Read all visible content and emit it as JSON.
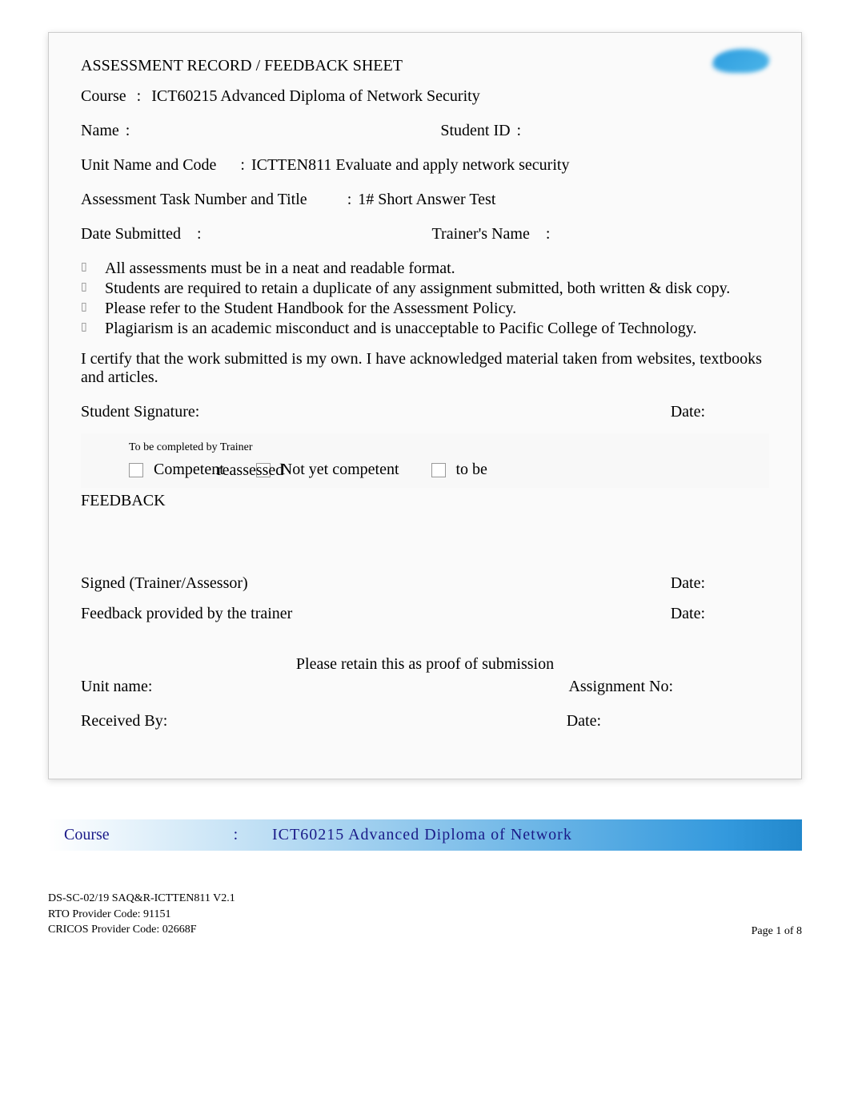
{
  "form": {
    "title": "ASSESSMENT RECORD / FEEDBACK SHEET",
    "course_label": "Course",
    "course_value": "ICT60215 Advanced Diploma of Network Security",
    "name_label": "Name",
    "student_id_label": "Student ID",
    "unit_label": "Unit Name and Code",
    "unit_value": "ICTTEN811 Evaluate and apply network security",
    "task_label": "Assessment Task Number and Title",
    "task_value": "1# Short Answer Test",
    "date_submitted_label": "Date Submitted",
    "trainer_name_label": "Trainer's Name",
    "bullets": [
      "All assessments must be in a neat and readable format.",
      "Students are required to retain a duplicate of any assignment submitted, both written & disk copy.",
      "Please refer to the Student Handbook for the Assessment Policy.",
      "Plagiarism is an academic misconduct and is unacceptable to Pacific College of Technology."
    ],
    "certify": "I certify that the work submitted is my own. I have acknowledged material taken from websites, textbooks and articles.",
    "student_signature_label": "Student Signature:",
    "date_label": "Date:",
    "trainer_box": {
      "header": "To be completed by Trainer",
      "competent": "Competent",
      "not_yet": "Not yet competent",
      "to_be": "to be",
      "reassessed": "reassessed"
    },
    "feedback_label": "FEEDBACK",
    "signed_label": "Signed (Trainer/Assessor)",
    "feedback_provided_label": "Feedback provided by the trainer",
    "receipt": {
      "header": "Please retain this as proof of submission",
      "unit_name_label": "Unit name:",
      "assignment_no_label": "Assignment No:",
      "received_by_label": "Received By:",
      "date_label": "Date:"
    }
  },
  "course_footer": {
    "label": "Course",
    "value": "ICT60215 Advanced Diploma of Network"
  },
  "page_footer": {
    "line1": "DS-SC-02/19 SAQ&R-ICTTEN811 V2.1",
    "line2": "RTO Provider Code: 91151",
    "line3": "CRICOS Provider Code: 02668F",
    "page": "Page 1 of 8"
  }
}
